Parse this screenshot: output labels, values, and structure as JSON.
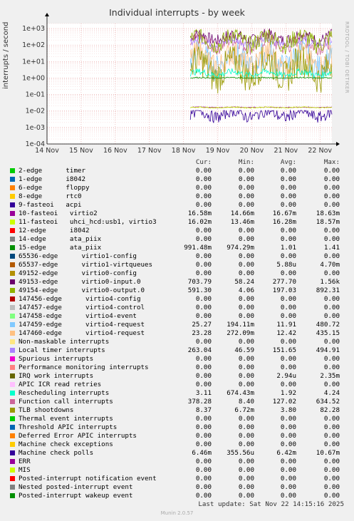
{
  "watermark": "RRDTOOL / TOBI OETIKER",
  "footer": {
    "last_update": "Last update: Sat Nov 22 14:15:16 2025",
    "munin": "Munin 2.0.57"
  },
  "legend_header": {
    "cur": "Cur:",
    "min": "Min:",
    "avg": "Avg:",
    "max": "Max:"
  },
  "legend": [
    {
      "name": "2-edge      timer",
      "color": "#00cc00",
      "cur": "0.00",
      "min": "0.00",
      "avg": "0.00",
      "max": "0.00"
    },
    {
      "name": "1-edge      i8042",
      "color": "#0066b3",
      "cur": "0.00",
      "min": "0.00",
      "avg": "0.00",
      "max": "0.00"
    },
    {
      "name": "6-edge      floppy",
      "color": "#ff8000",
      "cur": "0.00",
      "min": "0.00",
      "avg": "0.00",
      "max": "0.00"
    },
    {
      "name": "8-edge      rtc0",
      "color": "#ffcc00",
      "cur": "0.00",
      "min": "0.00",
      "avg": "0.00",
      "max": "0.00"
    },
    {
      "name": "9-fasteoi   acpi",
      "color": "#330099",
      "cur": "0.00",
      "min": "0.00",
      "avg": "0.00",
      "max": "0.00"
    },
    {
      "name": "10-fasteoi   virtio2",
      "color": "#990099",
      "cur": "16.58m",
      "min": "14.66m",
      "avg": "16.67m",
      "max": "18.63m"
    },
    {
      "name": "11-fasteoi   uhci_hcd:usb1, virtio3",
      "color": "#ccff00",
      "cur": "16.02m",
      "min": "13.46m",
      "avg": "16.28m",
      "max": "18.57m"
    },
    {
      "name": "12-edge      i8042",
      "color": "#ff0000",
      "cur": "0.00",
      "min": "0.00",
      "avg": "0.00",
      "max": "0.00"
    },
    {
      "name": "14-edge      ata_piix",
      "color": "#808080",
      "cur": "0.00",
      "min": "0.00",
      "avg": "0.00",
      "max": "0.00"
    },
    {
      "name": "15-edge      ata_piix",
      "color": "#008f00",
      "cur": "991.48m",
      "min": "974.29m",
      "avg": "1.01",
      "max": "1.41"
    },
    {
      "name": "65536-edge      virtio1-config",
      "color": "#00487d",
      "cur": "0.00",
      "min": "0.00",
      "avg": "0.00",
      "max": "0.00"
    },
    {
      "name": "65537-edge      virtio1-virtqueues",
      "color": "#b35a00",
      "cur": "0.00",
      "min": "0.00",
      "avg": "5.88u",
      "max": "4.70m"
    },
    {
      "name": "49152-edge      virtio0-config",
      "color": "#b38f00",
      "cur": "0.00",
      "min": "0.00",
      "avg": "0.00",
      "max": "0.00"
    },
    {
      "name": "49153-edge      virtio0-input.0",
      "color": "#6b006b",
      "cur": "703.79",
      "min": "58.24",
      "avg": "277.70",
      "max": "1.56k"
    },
    {
      "name": "49154-edge      virtio0-output.0",
      "color": "#8fb300",
      "cur": "591.30",
      "min": "4.06",
      "avg": "197.03",
      "max": "892.31"
    },
    {
      "name": "147456-edge      virtio4-config",
      "color": "#b30000",
      "cur": "0.00",
      "min": "0.00",
      "avg": "0.00",
      "max": "0.00"
    },
    {
      "name": "147457-edge      virtio4-control",
      "color": "#bebebe",
      "cur": "0.00",
      "min": "0.00",
      "avg": "0.00",
      "max": "0.00"
    },
    {
      "name": "147458-edge      virtio4-event",
      "color": "#80ff80",
      "cur": "0.00",
      "min": "0.00",
      "avg": "0.00",
      "max": "0.00"
    },
    {
      "name": "147459-edge      virtio4-request",
      "color": "#80c9ff",
      "cur": "25.27",
      "min": "194.11m",
      "avg": "11.91",
      "max": "480.72"
    },
    {
      "name": "147460-edge      virtio4-request",
      "color": "#ffc080",
      "cur": "23.28",
      "min": "272.09m",
      "avg": "12.42",
      "max": "435.15"
    },
    {
      "name": "Non-maskable interrupts",
      "color": "#ffe680",
      "cur": "0.00",
      "min": "0.00",
      "avg": "0.00",
      "max": "0.00"
    },
    {
      "name": "Local timer interrupts",
      "color": "#aa80ff",
      "cur": "263.04",
      "min": "46.59",
      "avg": "151.65",
      "max": "494.91"
    },
    {
      "name": "Spurious interrupts",
      "color": "#ee00cc",
      "cur": "0.00",
      "min": "0.00",
      "avg": "0.00",
      "max": "0.00"
    },
    {
      "name": "Performance monitoring interrupts",
      "color": "#ff8080",
      "cur": "0.00",
      "min": "0.00",
      "avg": "0.00",
      "max": "0.00"
    },
    {
      "name": "IRQ work interrupts",
      "color": "#666600",
      "cur": "0.00",
      "min": "0.00",
      "avg": "2.94u",
      "max": "2.35m"
    },
    {
      "name": "APIC ICR read retries",
      "color": "#ffbfff",
      "cur": "0.00",
      "min": "0.00",
      "avg": "0.00",
      "max": "0.00"
    },
    {
      "name": "Rescheduling interrupts",
      "color": "#00ffcc",
      "cur": "3.11",
      "min": "674.43m",
      "avg": "1.92",
      "max": "4.24"
    },
    {
      "name": "Function call interrupts",
      "color": "#cc6699",
      "cur": "378.28",
      "min": "8.40",
      "avg": "127.02",
      "max": "634.52"
    },
    {
      "name": "TLB shootdowns",
      "color": "#999900",
      "cur": "8.37",
      "min": "6.72m",
      "avg": "3.80",
      "max": "82.28"
    },
    {
      "name": "Thermal event interrupts",
      "color": "#00cc00",
      "cur": "0.00",
      "min": "0.00",
      "avg": "0.00",
      "max": "0.00"
    },
    {
      "name": "Threshold APIC interrupts",
      "color": "#0066b3",
      "cur": "0.00",
      "min": "0.00",
      "avg": "0.00",
      "max": "0.00"
    },
    {
      "name": "Deferred Error APIC interrupts",
      "color": "#ff8000",
      "cur": "0.00",
      "min": "0.00",
      "avg": "0.00",
      "max": "0.00"
    },
    {
      "name": "Machine check exceptions",
      "color": "#ffcc00",
      "cur": "0.00",
      "min": "0.00",
      "avg": "0.00",
      "max": "0.00"
    },
    {
      "name": "Machine check polls",
      "color": "#330099",
      "cur": "6.46m",
      "min": "355.56u",
      "avg": "6.42m",
      "max": "10.67m"
    },
    {
      "name": "ERR",
      "color": "#990099",
      "cur": "0.00",
      "min": "0.00",
      "avg": "0.00",
      "max": "0.00"
    },
    {
      "name": "MIS",
      "color": "#ccff00",
      "cur": "0.00",
      "min": "0.00",
      "avg": "0.00",
      "max": "0.00"
    },
    {
      "name": "Posted-interrupt notification event",
      "color": "#ff0000",
      "cur": "0.00",
      "min": "0.00",
      "avg": "0.00",
      "max": "0.00"
    },
    {
      "name": "Nested posted-interrupt event",
      "color": "#808080",
      "cur": "0.00",
      "min": "0.00",
      "avg": "0.00",
      "max": "0.00"
    },
    {
      "name": "Posted-interrupt wakeup event",
      "color": "#008f00",
      "cur": "0.00",
      "min": "0.00",
      "avg": "0.00",
      "max": "0.00"
    }
  ],
  "chart_data": {
    "type": "line",
    "title": "Individual interrupts - by week",
    "ylabel": "interrupts / second",
    "xlabel": "",
    "yscale": "log",
    "ylim": [
      0.0001,
      2000
    ],
    "yticks": [
      "1e-04",
      "1e-03",
      "1e-02",
      "1e-01",
      "1e+00",
      "1e+01",
      "1e+02",
      "1e+03"
    ],
    "xticks": [
      "14 Nov",
      "15 Nov",
      "16 Nov",
      "17 Nov",
      "18 Nov",
      "19 Nov",
      "20 Nov",
      "21 Nov",
      "22 Nov"
    ],
    "grid": true,
    "data_start_day": 18.2,
    "series": [
      {
        "name": "49153-edge virtio0-input.0",
        "color": "#6b006b",
        "level": 300,
        "low": 60,
        "high": 1500
      },
      {
        "name": "Function call interrupts",
        "color": "#cc6699",
        "level": 120,
        "low": 10,
        "high": 600
      },
      {
        "name": "Local timer interrupts",
        "color": "#aa80ff",
        "level": 150,
        "low": 50,
        "high": 480
      },
      {
        "name": "49154-edge virtio0-output.0",
        "color": "#8fb300",
        "level": 200,
        "low": 5,
        "high": 850
      },
      {
        "name": "147459-edge virtio4-request",
        "color": "#80c9ff",
        "level": 12,
        "low": 0.2,
        "high": 450
      },
      {
        "name": "147460-edge virtio4-request",
        "color": "#ffc080",
        "level": 12,
        "low": 0.3,
        "high": 400
      },
      {
        "name": "TLB shootdowns",
        "color": "#999900",
        "level": 3.8,
        "low": 0.007,
        "high": 80
      },
      {
        "name": "Rescheduling interrupts",
        "color": "#00ffcc",
        "level": 1.9,
        "low": 0.7,
        "high": 4.2
      },
      {
        "name": "15-edge ata_piix",
        "color": "#008f00",
        "level": 1.01,
        "low": 0.97,
        "high": 1.4
      },
      {
        "name": "10-fasteoi virtio2",
        "color": "#990099",
        "level": 0.0167,
        "low": 0.0147,
        "high": 0.0186
      },
      {
        "name": "11-fasteoi uhci_hcd:usb1, virtio3",
        "color": "#ccff00",
        "level": 0.0163,
        "low": 0.0135,
        "high": 0.0186
      },
      {
        "name": "Machine check polls",
        "color": "#330099",
        "level": 0.0064,
        "low": 0.0004,
        "high": 0.0107
      }
    ]
  }
}
